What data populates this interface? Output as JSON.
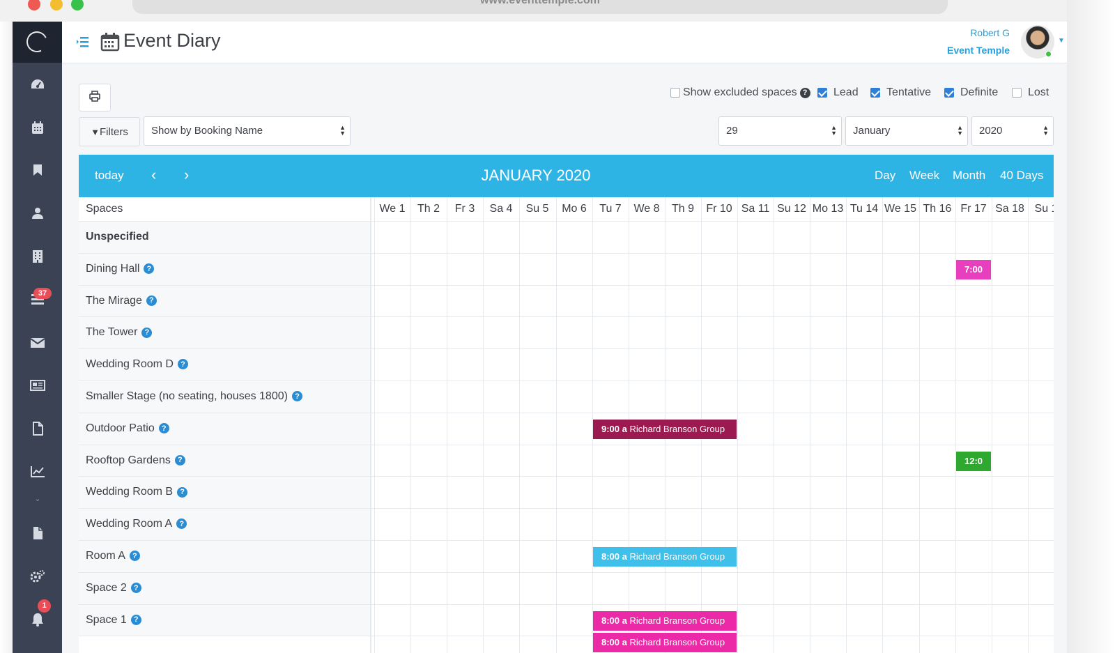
{
  "browser": {
    "url": "www.eventtemple.com"
  },
  "header": {
    "title": "Event Diary",
    "user_name": "Robert G",
    "user_org": "Event Temple"
  },
  "sidebar": {
    "items": [
      {
        "icon": "dashboard-icon"
      },
      {
        "icon": "calendar-icon"
      },
      {
        "icon": "bookmark-icon"
      },
      {
        "icon": "user-icon"
      },
      {
        "icon": "building-icon"
      },
      {
        "icon": "tasks-icon",
        "badge": "37"
      },
      {
        "icon": "envelope-icon"
      },
      {
        "icon": "newspaper-icon"
      },
      {
        "icon": "file-icon"
      },
      {
        "icon": "chart-icon"
      },
      {
        "icon": "document-icon"
      },
      {
        "icon": "settings-icon"
      },
      {
        "icon": "bell-icon",
        "badge": "1"
      }
    ]
  },
  "toolbar": {
    "filters_label": "Filters",
    "show_by": "Show by Booking Name",
    "day": "29",
    "month": "January",
    "year": "2020",
    "show_excluded": "Show excluded spaces",
    "statuses": [
      {
        "label": "Lead",
        "checked": true
      },
      {
        "label": "Tentative",
        "checked": true
      },
      {
        "label": "Definite",
        "checked": true
      },
      {
        "label": "Lost",
        "checked": false
      }
    ]
  },
  "calendar": {
    "today_label": "today",
    "title": "JANUARY 2020",
    "views": [
      "Day",
      "Week",
      "Month",
      "40 Days"
    ],
    "spaces_header": "Spaces",
    "days": [
      "We 1",
      "Th 2",
      "Fr 3",
      "Sa 4",
      "Su 5",
      "Mo 6",
      "Tu 7",
      "We 8",
      "Th 9",
      "Fr 10",
      "Sa 11",
      "Su 12",
      "Mo 13",
      "Tu 14",
      "We 15",
      "Th 16",
      "Fr 17",
      "Sa 18",
      "Su 1"
    ],
    "spaces": [
      {
        "name": "Unspecified",
        "bold": true,
        "info": false
      },
      {
        "name": "Dining Hall",
        "info": true
      },
      {
        "name": "The Mirage",
        "info": true
      },
      {
        "name": "The Tower",
        "info": true
      },
      {
        "name": "Wedding Room D",
        "info": true
      },
      {
        "name": "Smaller Stage (no seating, houses 1800)",
        "info": true
      },
      {
        "name": "Outdoor Patio",
        "info": true
      },
      {
        "name": "Rooftop Gardens",
        "info": true
      },
      {
        "name": "Wedding Room B",
        "info": true
      },
      {
        "name": "Wedding Room A",
        "info": true
      },
      {
        "name": "Room A",
        "info": true
      },
      {
        "name": "Space 2",
        "info": true
      },
      {
        "name": "Space 1",
        "info": true
      }
    ],
    "events": [
      {
        "space": 1,
        "day": 16,
        "span": 1,
        "time": "7:00",
        "name": "",
        "color": "#e83fbe"
      },
      {
        "space": 6,
        "day": 6,
        "span": 4,
        "time": "9:00 a",
        "name": "Richard Branson Group",
        "color": "#9b1a4f"
      },
      {
        "space": 7,
        "day": 16,
        "span": 1,
        "time": "12:0",
        "name": "",
        "color": "#2ea82e"
      },
      {
        "space": 10,
        "day": 6,
        "span": 4,
        "time": "8:00 a",
        "name": "Richard Branson Group",
        "color": "#3ec0ea"
      },
      {
        "space": 12,
        "day": 6,
        "span": 4,
        "time": "8:00 a",
        "name": "Richard Branson Group",
        "color": "#ec2aa8"
      },
      {
        "space": 12,
        "day": 6,
        "span": 4,
        "time": "8:00 a",
        "name": "Richard Branson Group",
        "color": "#ec2aa8",
        "stack": 1
      }
    ]
  },
  "colors": {
    "accent": "#2db4e5",
    "sidebar": "#3a4253",
    "link": "#2a9ed9"
  }
}
